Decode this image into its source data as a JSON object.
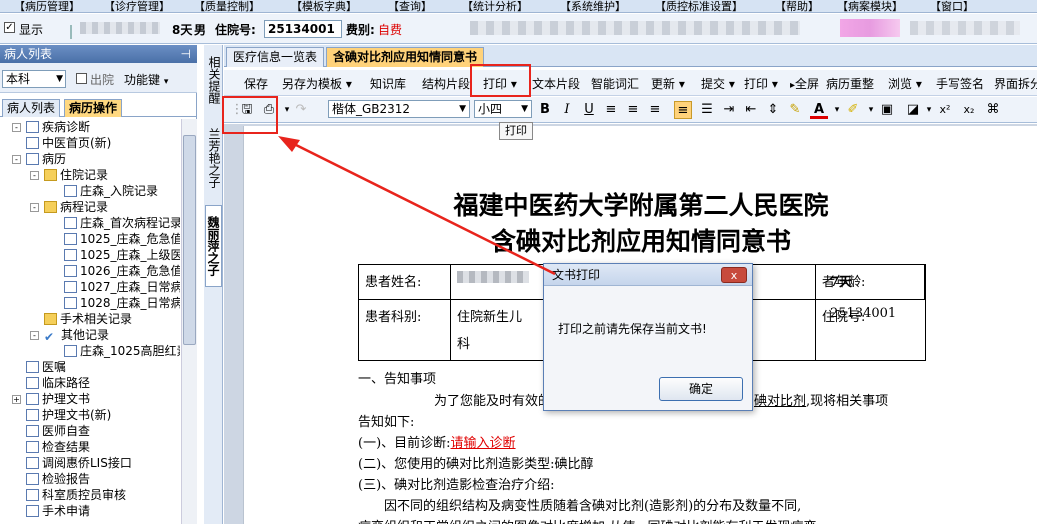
{
  "menubar": {
    "items": [
      "【病历管理】",
      "【诊疗管理】",
      "【质量控制】",
      "【模板字典】",
      "【查询】",
      "【统计分析】",
      "【系统维护】",
      "【质控标准设置】",
      "【帮助】",
      "【病案模块】",
      "【窗口】"
    ]
  },
  "infobar": {
    "show_label": "显示",
    "age": "8天",
    "gender": "男",
    "admission_label": "住院号:",
    "admission_no": "25134001",
    "fee_label": "费别:",
    "fee_value": "自费"
  },
  "left_panel": {
    "header": "病人列表",
    "dept": "本科",
    "discharged_label": "出院",
    "function_key": "功能键",
    "tabs": [
      "病人列表",
      "病历操作"
    ],
    "tree": [
      "疾病诊断",
      "中医首页(新)",
      "病历",
      "住院记录",
      "庄森_入院记录",
      "病程记录",
      "庄森_首次病程记录",
      "1025_庄森_危急值",
      "1025_庄森_上级医",
      "1026_庄森_危急值",
      "1027_庄森_日常病",
      "1028_庄森_日常病",
      "手术相关记录",
      "其他记录",
      "庄森_1025高胆红素",
      "医嘱",
      "临床路径",
      "护理文书",
      "护理文书(新)",
      "医师自查",
      "检查结果",
      "调阅惠侨LIS接口",
      "检验报告",
      "科室质控员审核",
      "手术申请"
    ]
  },
  "vstrip": {
    "tab1": "相关提醒",
    "tab2": "兰芳艳之子",
    "tab3": "魏丽萍之子"
  },
  "doc_tabs": [
    "医疗信息一览表",
    "含碘对比剂应用知情同意书"
  ],
  "toolbar1": [
    "保存",
    "另存为模板",
    "知识库",
    "结构片段",
    "打印",
    "文本片段",
    "智能词汇",
    "更新",
    "提交",
    "打印",
    "全屏",
    "病历重整",
    "浏览",
    "手写签名",
    "界面拆分"
  ],
  "toolbar2": {
    "font": "楷体_GB2312",
    "size": "小四",
    "tooltip": "打印"
  },
  "document": {
    "hospital": "福建中医药大学附属第二人民医院",
    "title": "含碘对比剂应用知情同意书",
    "patient_name_label": "患者姓名:",
    "patient_age_label": "者年龄:",
    "patient_age": "7天",
    "dept_label": "患者科别:",
    "dept_value_1": "住院新生儿",
    "dept_value_2": "科",
    "admission_label": "住院号:",
    "admission_no": "25134001",
    "section1": "一、告知事项",
    "para1_a": "为了您能及时有效的治",
    "para1_b": "碘对比剂",
    "para1_c": ",现将相关事项",
    "para1_d": "告知如下:",
    "sub1_label": "(一)、目前诊断:",
    "sub1_value": "请输入诊断",
    "sub2": "(二)、您使用的碘对比剂造影类型:碘比醇",
    "sub3": "(三)、碘对比剂造影检查治疗介绍:",
    "para2": "因不同的组织结构及病变性质随着含碘对比剂(造影剂)的分布及数量不同,",
    "para3": "病变组织和正常组织之间的图像对比度增加,从使...同碘对比剂能有利于发现病变"
  },
  "dialog": {
    "title": "文书打印",
    "close": "x",
    "message": "打印之前请先保存当前文书!",
    "ok": "确定"
  },
  "colors": {
    "annotation_red": "#e8241c",
    "active_tab": "#ffd27a",
    "toolbar_bg": "#eef3fa"
  }
}
